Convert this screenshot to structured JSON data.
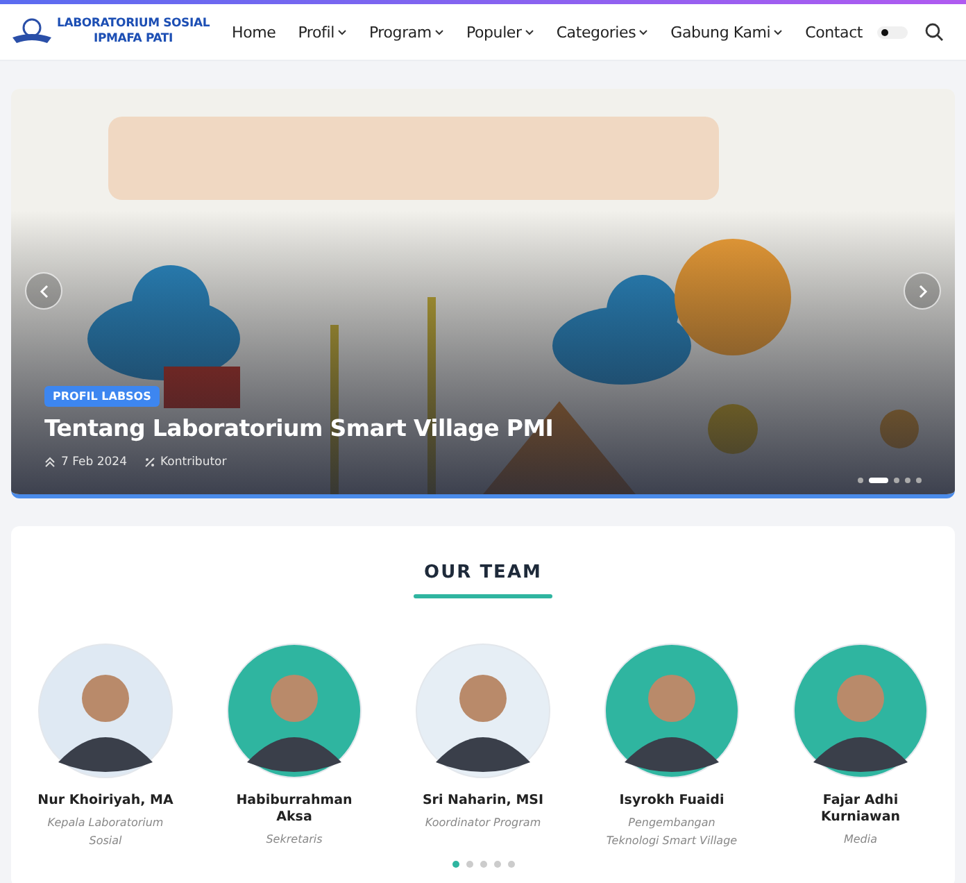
{
  "header": {
    "logo_lines": [
      "LABORATORIUM SOSIAL",
      "IPMAFA PATI"
    ],
    "nav": [
      {
        "label": "Home",
        "dropdown": false
      },
      {
        "label": "Profil",
        "dropdown": true
      },
      {
        "label": "Program",
        "dropdown": true
      },
      {
        "label": "Populer",
        "dropdown": true
      },
      {
        "label": "Categories",
        "dropdown": true
      },
      {
        "label": "Gabung Kami",
        "dropdown": true
      },
      {
        "label": "Contact",
        "dropdown": false
      }
    ],
    "theme_toggle": {
      "on": false
    }
  },
  "slider": {
    "badge": "PROFIL LABSOS",
    "title": "Tentang Laboratorium Smart Village PMI",
    "date": "7 Feb 2024",
    "author": "Kontributor",
    "dots": [
      {
        "selected": false
      },
      {
        "selected": true
      },
      {
        "selected": false
      },
      {
        "selected": false
      },
      {
        "selected": false
      }
    ]
  },
  "team": {
    "title": "OUR TEAM",
    "members": [
      {
        "name": "Nur Khoiriyah, MA",
        "role": "Kepala Laboratorium Sosial",
        "color": "#dfe9f3"
      },
      {
        "name": "Habiburrahman Aksa",
        "role": "Sekretaris",
        "color": "#2fb5a0"
      },
      {
        "name": "Sri Naharin, MSI",
        "role": "Koordinator Program",
        "color": "#e6eef5"
      },
      {
        "name": "Isyrokh Fuaidi",
        "role": "Pengembangan Teknologi Smart Village",
        "color": "#2fb5a0"
      },
      {
        "name": "Fajar Adhi Kurniawan",
        "role": "Media",
        "color": "#2fb5a0"
      }
    ],
    "dots": [
      {
        "selected": true
      },
      {
        "selected": false
      },
      {
        "selected": false
      },
      {
        "selected": false
      },
      {
        "selected": false
      }
    ]
  }
}
